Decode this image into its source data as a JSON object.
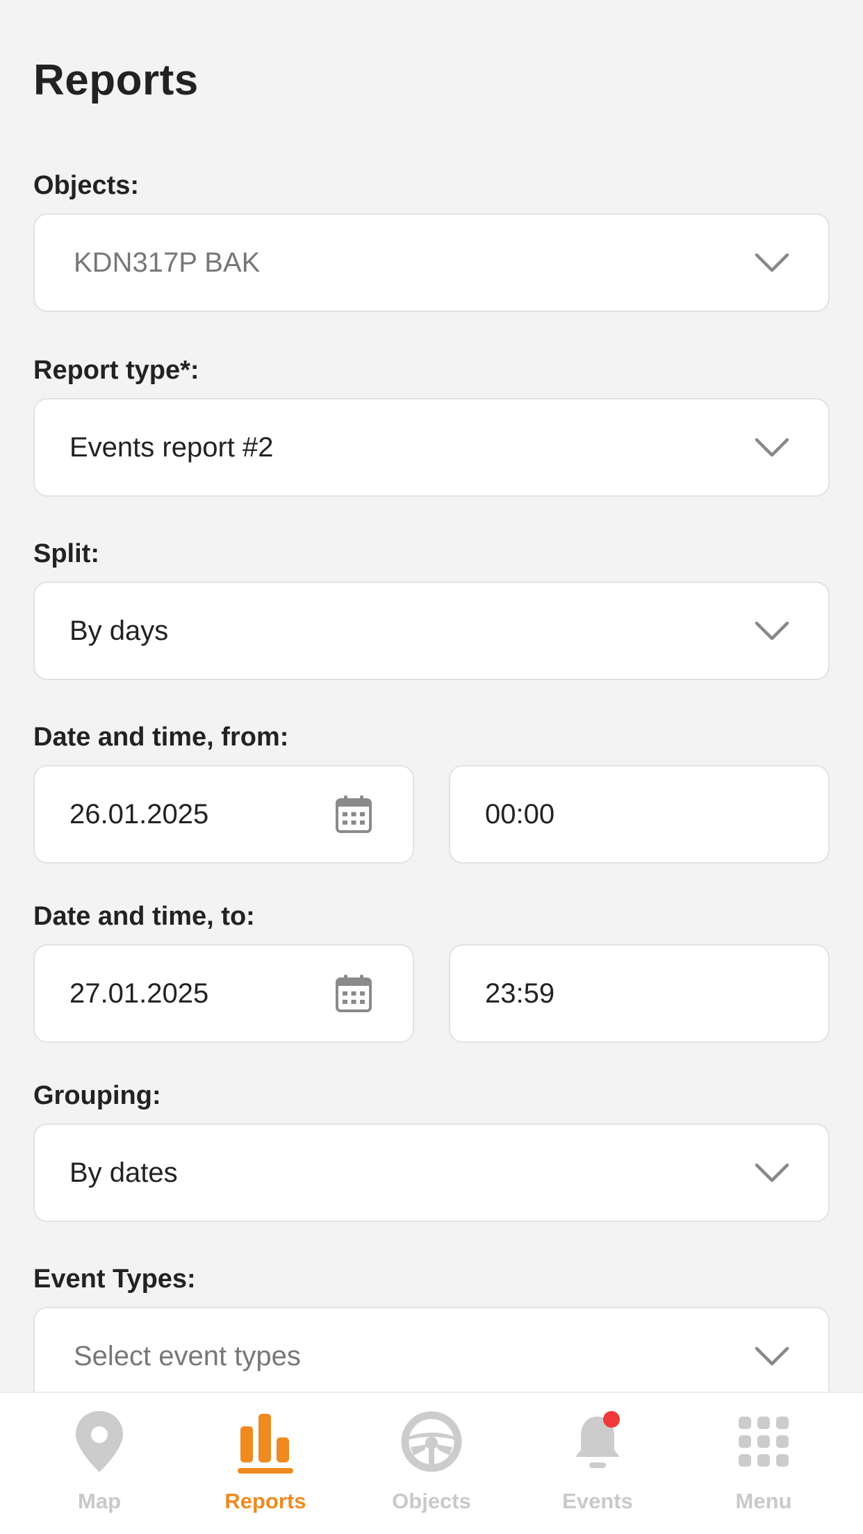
{
  "page": {
    "title": "Reports"
  },
  "form": {
    "objects": {
      "label": "Objects:",
      "value": "KDN317P BAK"
    },
    "report_type": {
      "label": "Report type*:",
      "value": "Events report #2"
    },
    "split": {
      "label": "Split:",
      "value": "By days"
    },
    "date_from": {
      "label": "Date and time, from:",
      "date": "26.01.2025",
      "time": "00:00"
    },
    "date_to": {
      "label": "Date and time, to:",
      "date": "27.01.2025",
      "time": "23:59"
    },
    "grouping": {
      "label": "Grouping:",
      "value": "By dates"
    },
    "event_types": {
      "label": "Event Types:",
      "placeholder": "Select event types"
    }
  },
  "nav": {
    "items": [
      {
        "label": "Map",
        "icon": "map-pin-icon"
      },
      {
        "label": "Reports",
        "icon": "bar-chart-icon"
      },
      {
        "label": "Objects",
        "icon": "steering-wheel-icon"
      },
      {
        "label": "Events",
        "icon": "bell-icon"
      },
      {
        "label": "Menu",
        "icon": "grid-icon"
      }
    ],
    "active": "Reports",
    "notification_dot": true
  },
  "colors": {
    "accent": "#ee8a1f",
    "inactive": "#c9c9c9",
    "badge": "#f03a3a",
    "background": "#f3f3f3"
  }
}
